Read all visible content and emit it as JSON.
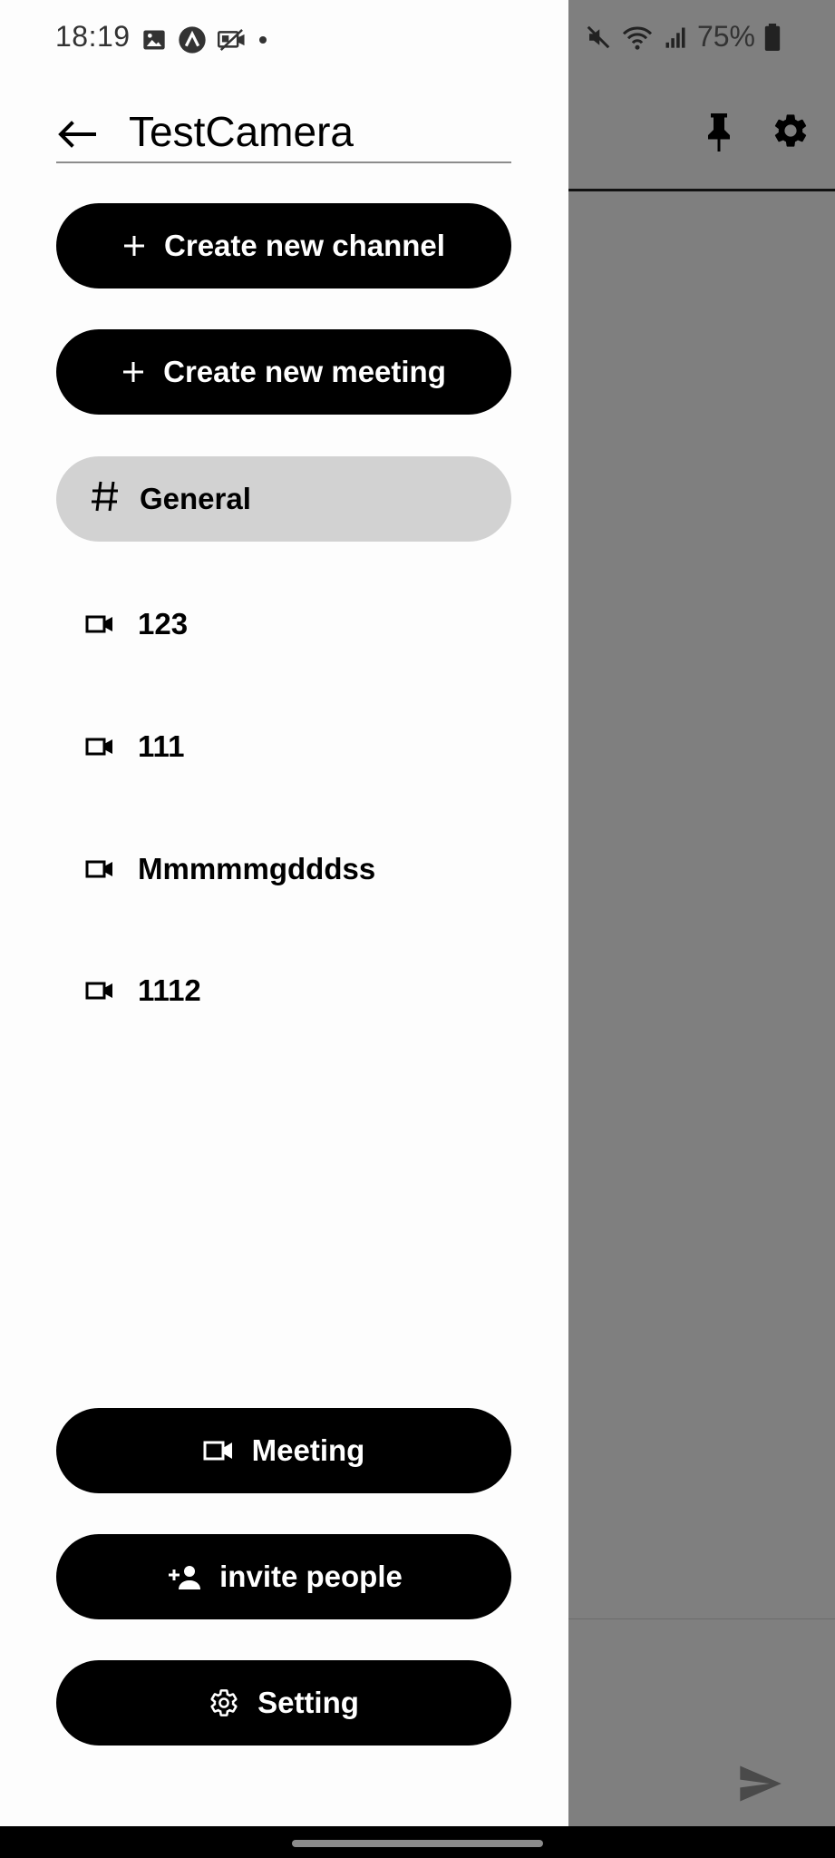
{
  "status_bar": {
    "time": "18:19",
    "battery_percent": "75%",
    "left_icons": [
      "gallery-icon",
      "app-logo-icon",
      "camera-off-icon",
      "dot-icon"
    ],
    "right_icons": [
      "mute-icon",
      "wifi-icon",
      "signal-icon",
      "battery-icon"
    ]
  },
  "drawer": {
    "title": "TestCamera",
    "actions": {
      "create_channel": "Create new channel",
      "create_meeting": "Create new meeting"
    },
    "channels": [
      {
        "label": "General",
        "selected": true
      }
    ],
    "meetings": [
      {
        "label": "123"
      },
      {
        "label": "111"
      },
      {
        "label": "Mmmmmgdddss"
      },
      {
        "label": "1112"
      }
    ],
    "footer_buttons": {
      "meeting": "Meeting",
      "invite": "invite people",
      "setting": "Setting"
    }
  },
  "background_app": {
    "header_icons": [
      "pin-icon",
      "gear-icon"
    ],
    "composer_icons": [
      "send-icon"
    ]
  },
  "colors": {
    "button_bg": "#000000",
    "selected_bg": "#d2d2d2",
    "scrim": "#7f7f7f"
  }
}
